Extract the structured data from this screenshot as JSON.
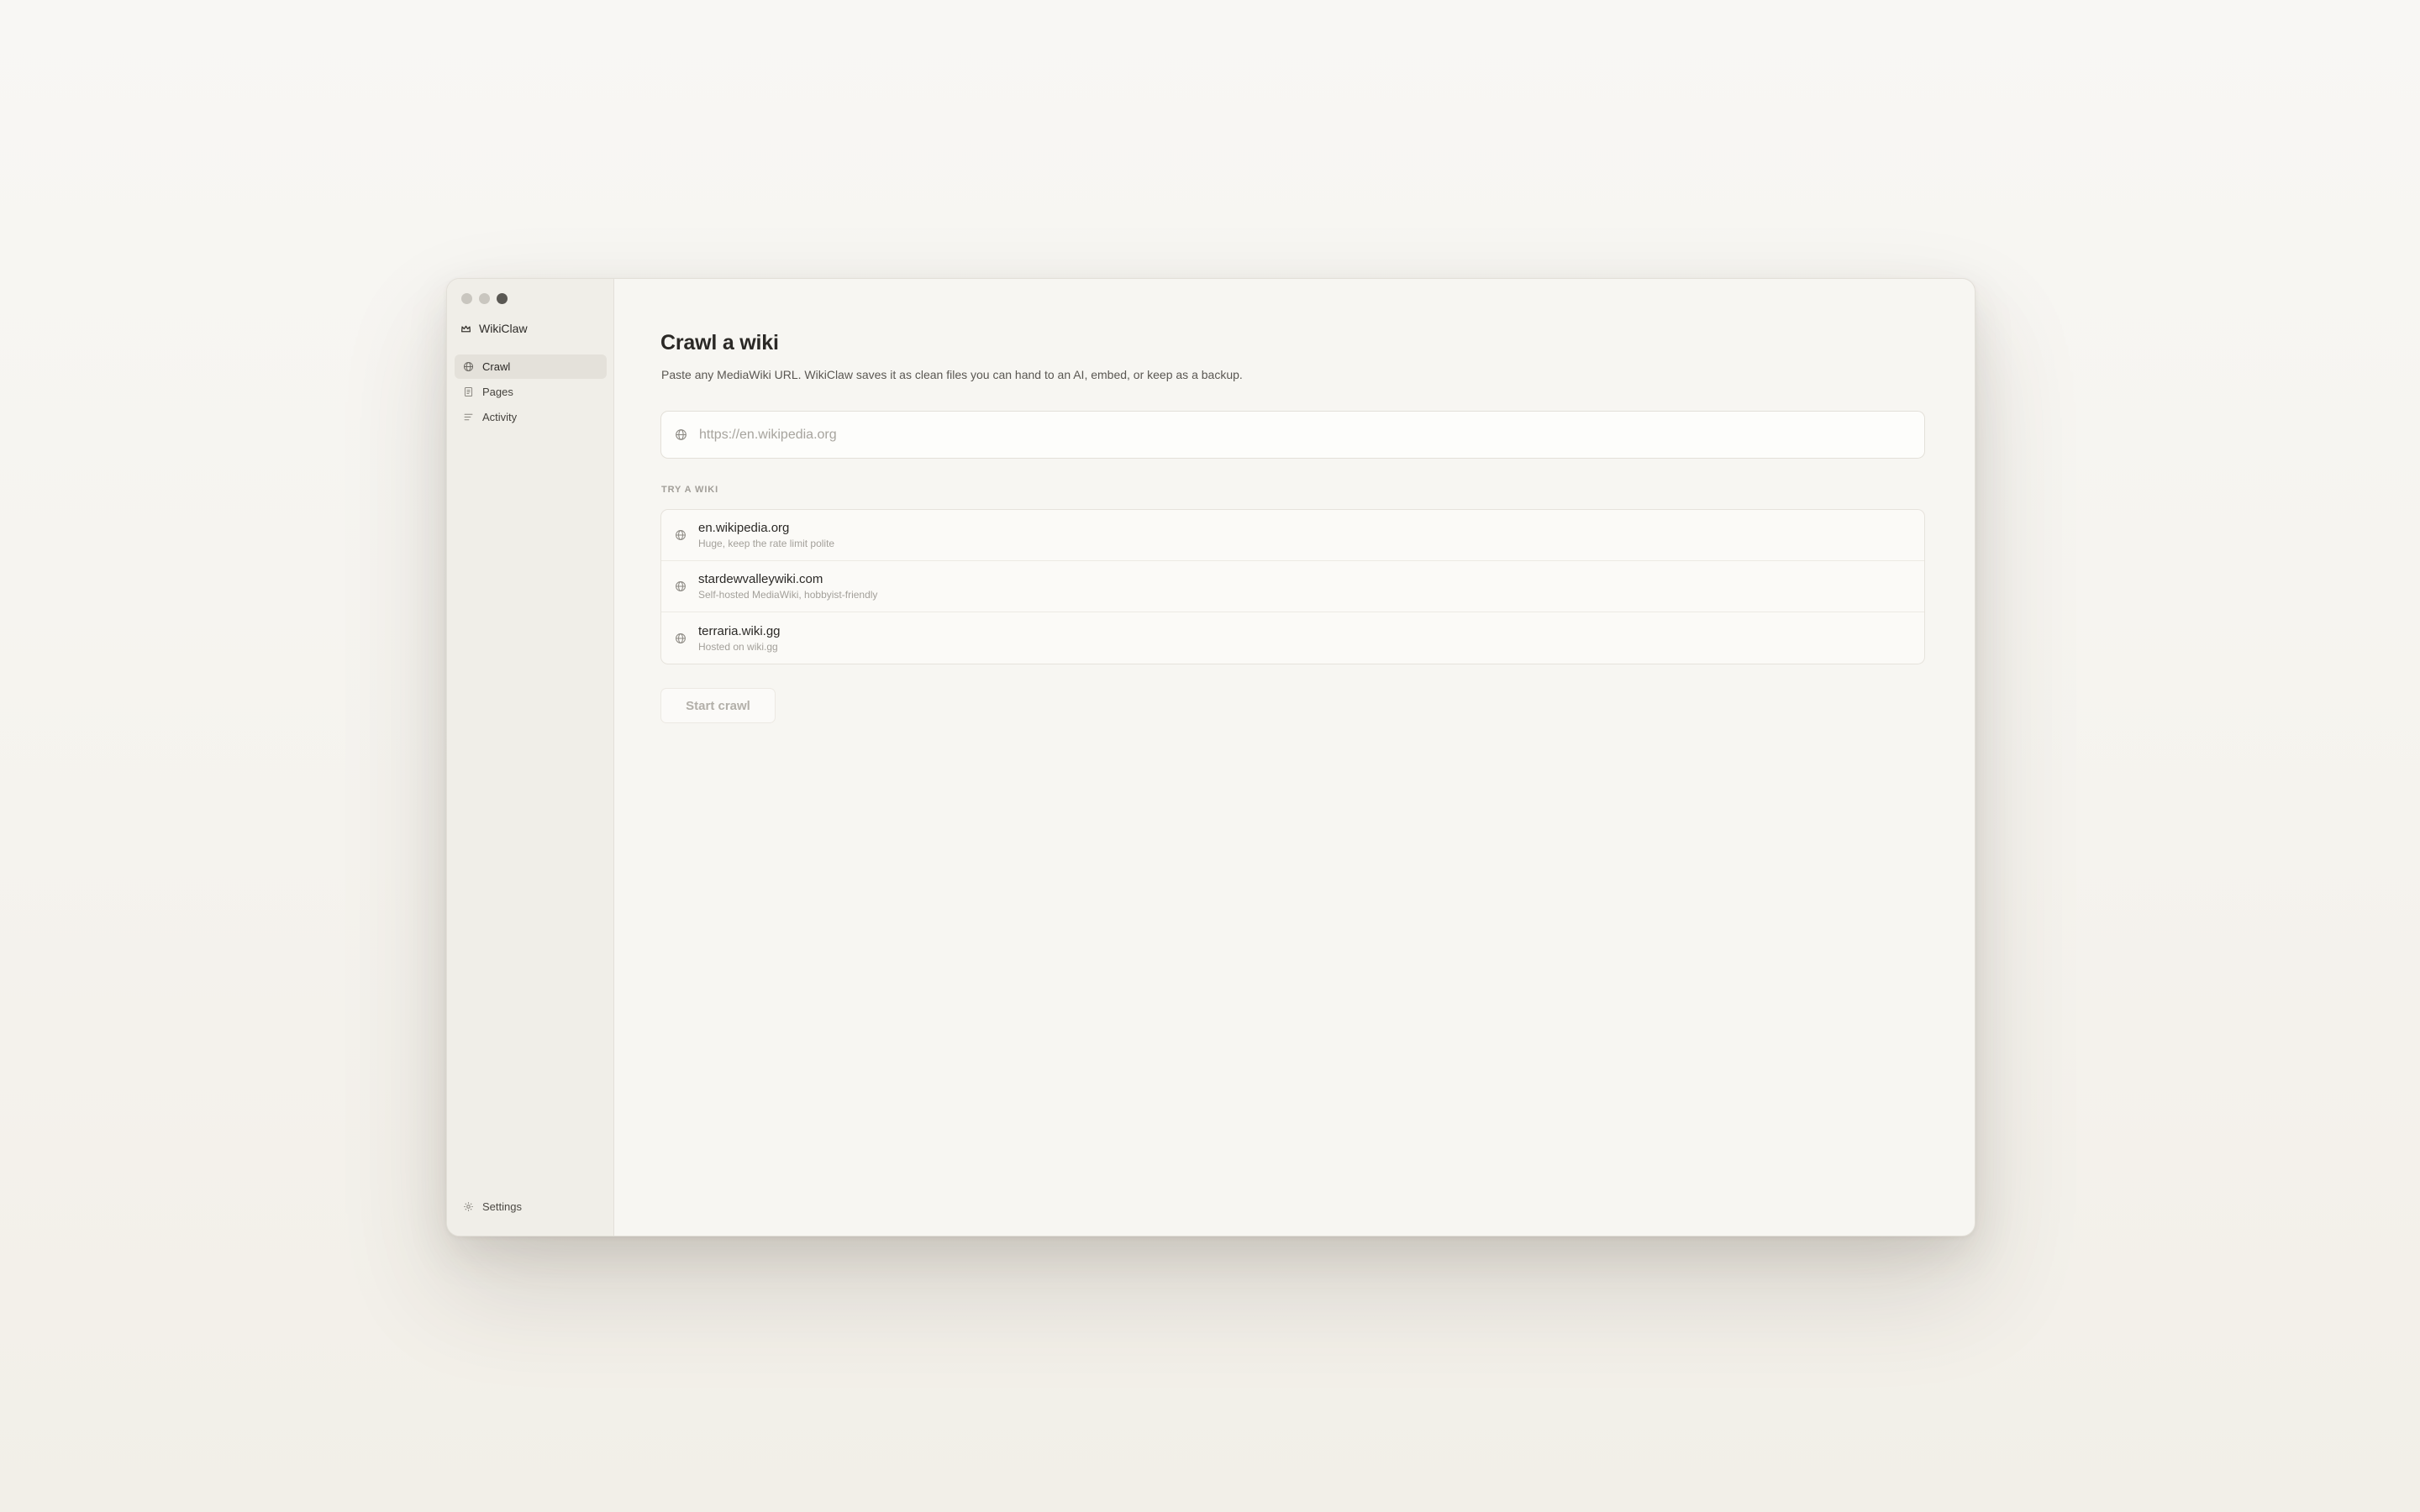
{
  "app": {
    "name": "WikiClaw",
    "logo_icon": "crown-icon"
  },
  "sidebar": {
    "items": [
      {
        "label": "Crawl",
        "icon": "globe-icon",
        "active": true
      },
      {
        "label": "Pages",
        "icon": "document-icon",
        "active": false
      },
      {
        "label": "Activity",
        "icon": "list-icon",
        "active": false
      }
    ],
    "settings": {
      "label": "Settings",
      "icon": "gear-icon"
    }
  },
  "main": {
    "title": "Crawl a wiki",
    "subtitle": "Paste any MediaWiki URL. WikiClaw saves it as clean files you can hand to an AI, embed, or keep as a backup.",
    "url_input": {
      "placeholder": "https://en.wikipedia.org",
      "value": "",
      "icon": "globe-icon"
    },
    "suggestions_label": "TRY A WIKI",
    "suggestions": [
      {
        "title": "en.wikipedia.org",
        "description": "Huge, keep the rate limit polite",
        "icon": "globe-icon"
      },
      {
        "title": "stardewvalleywiki.com",
        "description": "Self-hosted MediaWiki, hobbyist-friendly",
        "icon": "globe-icon"
      },
      {
        "title": "terraria.wiki.gg",
        "description": "Hosted on wiki.gg",
        "icon": "globe-icon"
      }
    ],
    "start_button": {
      "label": "Start crawl",
      "disabled": true
    }
  },
  "colors": {
    "background": "#f7f6f2",
    "sidebar_background": "#f0eee8",
    "active_nav": "#e4e1da",
    "text_primary": "#2b2926",
    "text_muted": "#a3a09a"
  }
}
